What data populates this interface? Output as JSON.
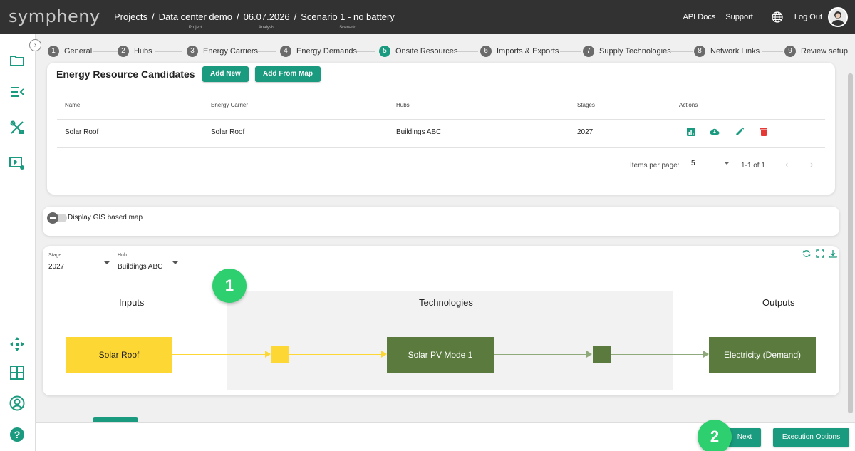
{
  "app": {
    "logo": "sympheny"
  },
  "breadcrumb": [
    {
      "label": "Projects",
      "sub": ""
    },
    {
      "label": "Data center demo",
      "sub": "Project"
    },
    {
      "label": "06.07.2026",
      "sub": "Analysis"
    },
    {
      "label": "Scenario 1 - no battery",
      "sub": "Scenario"
    }
  ],
  "header": {
    "api_docs": "API Docs",
    "support": "Support",
    "logout": "Log Out"
  },
  "sidebar": {
    "icons": [
      "folder-icon",
      "list-collapse-icon",
      "tools-icon",
      "play-settings-icon",
      "network-icon",
      "dashboard-icon",
      "account-icon",
      "help-icon"
    ]
  },
  "stepper": {
    "steps": [
      {
        "num": "1",
        "label": "General"
      },
      {
        "num": "2",
        "label": "Hubs"
      },
      {
        "num": "3",
        "label": "Energy Carriers"
      },
      {
        "num": "4",
        "label": "Energy Demands"
      },
      {
        "num": "5",
        "label": "Onsite Resources",
        "active": true
      },
      {
        "num": "6",
        "label": "Imports & Exports"
      },
      {
        "num": "7",
        "label": "Supply Technologies"
      },
      {
        "num": "8",
        "label": "Network Links"
      },
      {
        "num": "9",
        "label": "Review setup"
      }
    ]
  },
  "resources": {
    "title": "Energy Resource Candidates",
    "add_new": "Add New",
    "add_from_map": "Add From Map",
    "columns": {
      "name": "Name",
      "carrier": "Energy Carrier",
      "hubs": "Hubs",
      "stages": "Stages",
      "actions": "Actions"
    },
    "rows": [
      {
        "name": "Solar Roof",
        "carrier": "Solar Roof",
        "hubs": "Buildings ABC",
        "stages": "2027"
      }
    ],
    "pager": {
      "label": "Items per page:",
      "per_page": "5",
      "range": "1-1 of 1",
      "prev": "‹",
      "next": "›"
    }
  },
  "gis": {
    "label": "Display GIS based map",
    "enabled": false
  },
  "diagram": {
    "stage": {
      "label": "Stage",
      "value": "2027"
    },
    "hub": {
      "label": "Hub",
      "value": "Buildings ABC"
    },
    "columns": {
      "inputs": "Inputs",
      "technologies": "Technologies",
      "outputs": "Outputs"
    },
    "nodes": {
      "input": "Solar Roof",
      "tech": "Solar PV Mode 1",
      "output": "Electricity (Demand)"
    },
    "colors": {
      "input": "#fdd835",
      "tech": "#5a7a3e",
      "output": "#5a7a3e",
      "accent": "#1a9a7e",
      "badge": "#2ecf6f"
    }
  },
  "badges": {
    "one": "1",
    "two": "2"
  },
  "footer": {
    "next": "Next",
    "execution_options": "Execution Options"
  }
}
